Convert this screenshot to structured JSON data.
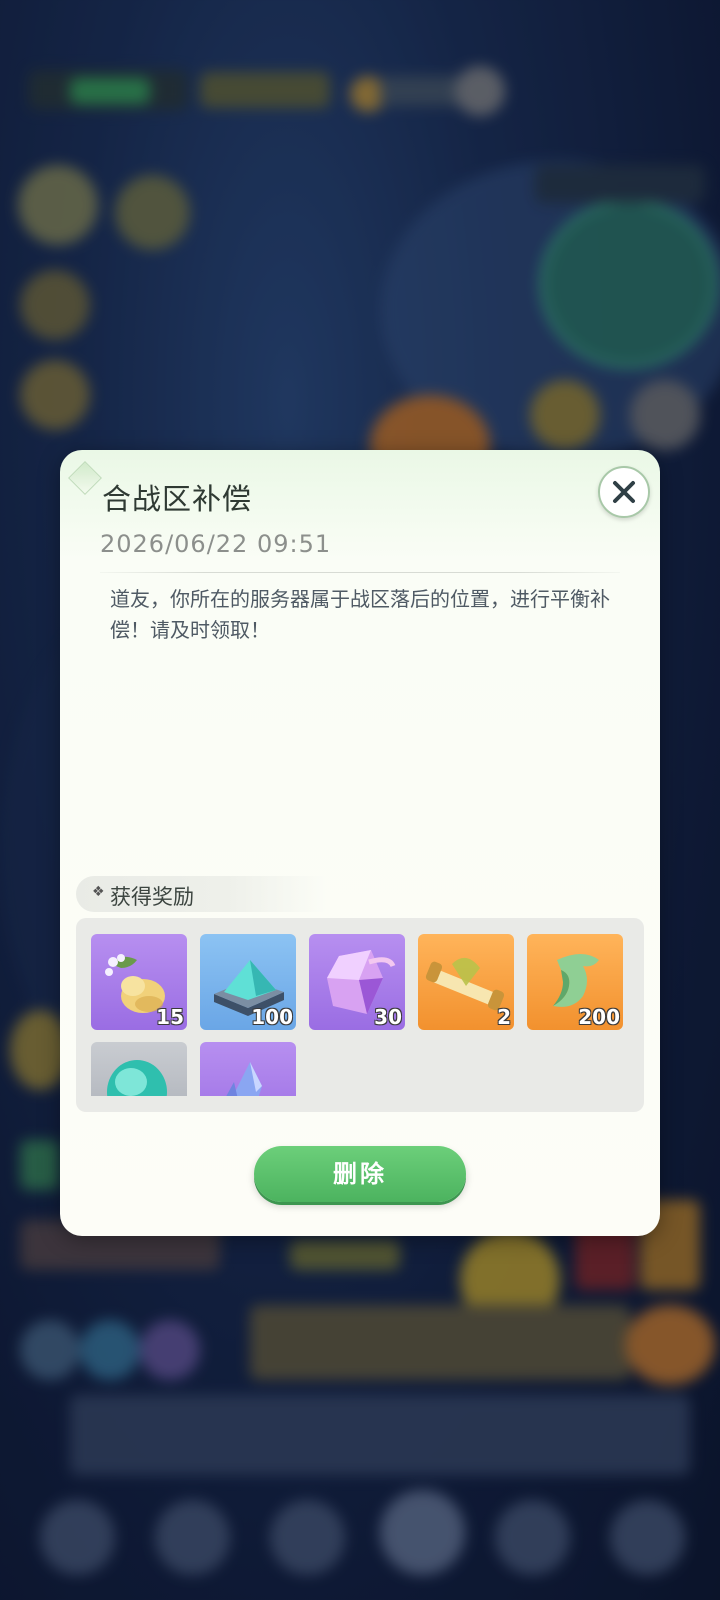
{
  "dialog": {
    "title": "合战区补偿",
    "date": "2026/06/22 09:51",
    "body": "道友，你所在的服务器属于战区落后的位置，进行平衡补偿！请及时领取！",
    "reward_header_mark": "❖",
    "reward_header": "获得奖励",
    "delete_label": "删除"
  },
  "rewards": [
    {
      "icon": "golden-gourd-fruit-icon",
      "quantity": "15",
      "rarity": "purple"
    },
    {
      "icon": "spirit-stone-chest-icon",
      "quantity": "100",
      "rarity": "blue"
    },
    {
      "icon": "purple-crystal-icon",
      "quantity": "30",
      "rarity": "purple"
    },
    {
      "icon": "golden-scroll-icon",
      "quantity": "2",
      "rarity": "orange"
    },
    {
      "icon": "jade-hook-icon",
      "quantity": "200",
      "rarity": "orange"
    },
    {
      "icon": "turquoise-gem-icon",
      "quantity": "",
      "rarity": "grey"
    },
    {
      "icon": "blue-shard-icon",
      "quantity": "",
      "rarity": "purple"
    }
  ],
  "colors": {
    "delete_button": "#4cb35f",
    "dialog_bg": "#fdfdf7",
    "purple_rarity": "#a97de9",
    "blue_rarity": "#7ab4ec",
    "orange_rarity": "#f7a244",
    "grey_rarity": "#b8bcc2"
  }
}
